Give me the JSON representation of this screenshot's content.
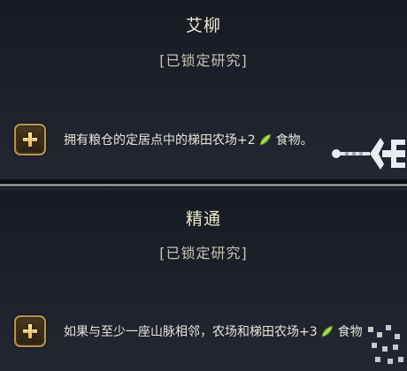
{
  "entries": [
    {
      "title": "艾柳",
      "status": "[已锁定研究]",
      "effect_before": "拥有粮仓的定居点中的梯田农场+2",
      "resource_icon": "food-leaf-icon",
      "effect_after": "食物。"
    },
    {
      "title": "精通",
      "status": "[已锁定研究]",
      "effect_before": "如果与至少一座山脉相邻，农场和梯田农场+3",
      "resource_icon": "food-leaf-icon",
      "effect_after": "食物"
    }
  ],
  "colors": {
    "title": "#f0e7cf",
    "status": "#c8c2b5",
    "text": "#e8e4da",
    "gold": "#b8954c",
    "food_green": "#8fc43b"
  }
}
